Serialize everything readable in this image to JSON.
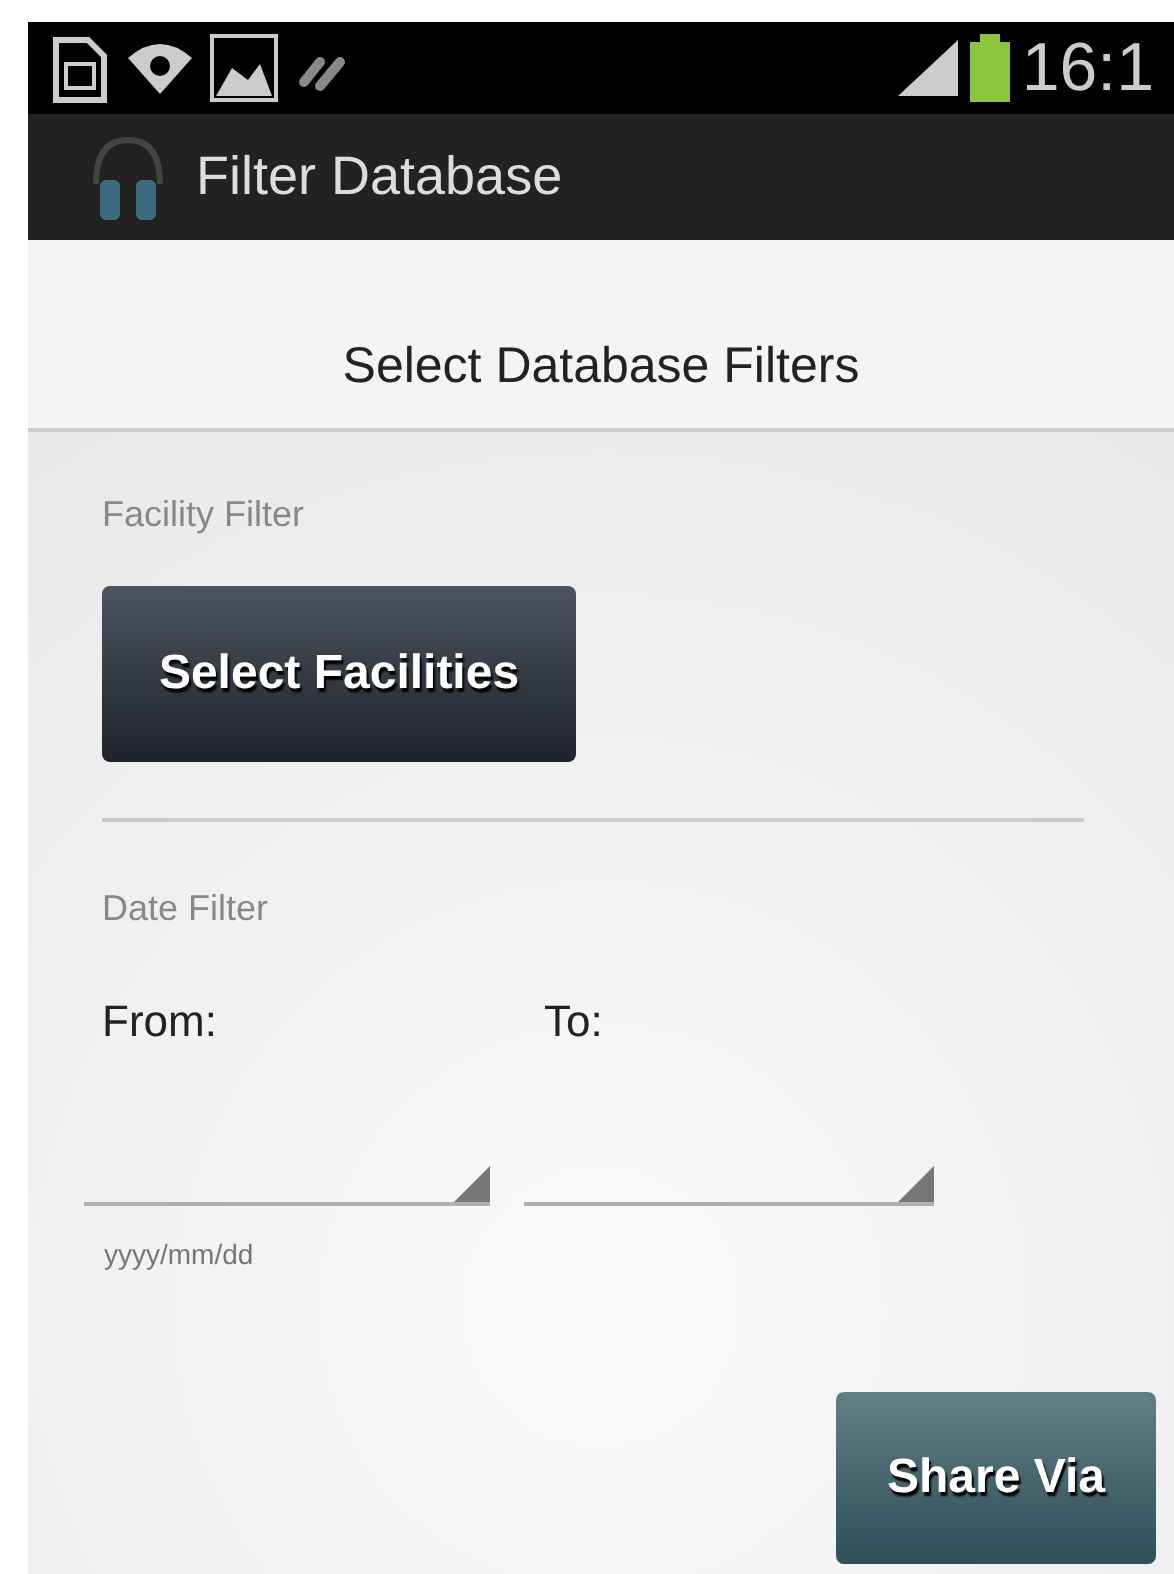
{
  "status_bar": {
    "time": "16:1"
  },
  "app_bar": {
    "title": "Filter Database"
  },
  "header": {
    "title": "Select Database Filters"
  },
  "facility_filter": {
    "label": "Facility Filter",
    "button": "Select Facilities"
  },
  "date_filter": {
    "label": "Date Filter",
    "from_label": "From:",
    "to_label": "To:",
    "format_hint": "yyyy/mm/dd"
  },
  "share_button": "Share Via"
}
